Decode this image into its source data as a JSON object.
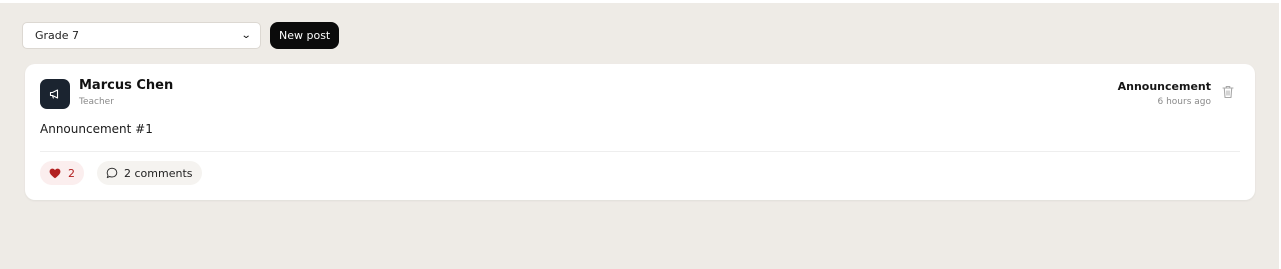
{
  "toolbar": {
    "grade_select": {
      "selected": "Grade 7"
    },
    "new_post_label": "New post"
  },
  "post": {
    "author": {
      "name": "Marcus Chen",
      "role": "Teacher",
      "avatar_icon": "megaphone-icon"
    },
    "type": "Announcement",
    "time": "6 hours ago",
    "body": "Announcement #1",
    "likes": "2",
    "comments_label": "2 comments",
    "delete_icon": "trash-icon"
  },
  "colors": {
    "background": "#eeebe6",
    "card": "#ffffff",
    "primary_button": "#0b0b0b",
    "avatar": "#1b2430",
    "like_accent": "#b22020",
    "like_bg": "#fbeeee"
  }
}
